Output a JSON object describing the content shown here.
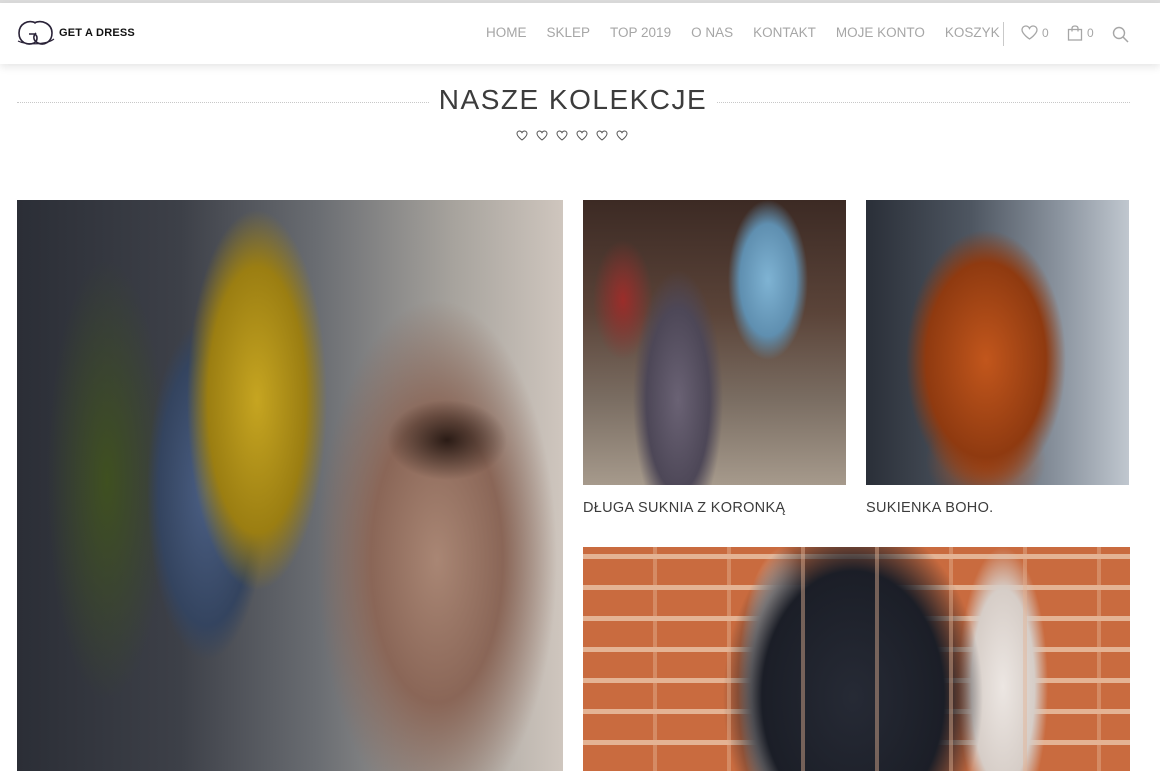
{
  "brand": {
    "name": "GET A DRESS",
    "logo_mark": "GD"
  },
  "nav": {
    "items": [
      "HOME",
      "SKLEP",
      "TOP 2019",
      "O NAS",
      "KONTAKT",
      "MOJE KONTO",
      "KOSZYK"
    ]
  },
  "header_icons": {
    "wishlist": {
      "icon": "heart-icon",
      "count": "0"
    },
    "cart": {
      "icon": "shopping-bag-icon",
      "count": "0"
    },
    "search": {
      "icon": "search-icon"
    }
  },
  "section": {
    "title": "NASZE KOLEKCJE",
    "ornament": "heart-icon"
  },
  "products": [
    {
      "caption": "DŁUGA SUKNIA Z KORONKĄ"
    },
    {
      "caption": "SUKIENKA BOHO."
    }
  ],
  "colors": {
    "nav_text": "#a6a6a6",
    "title_text": "#3c3c3c",
    "logo_text": "#111111"
  }
}
